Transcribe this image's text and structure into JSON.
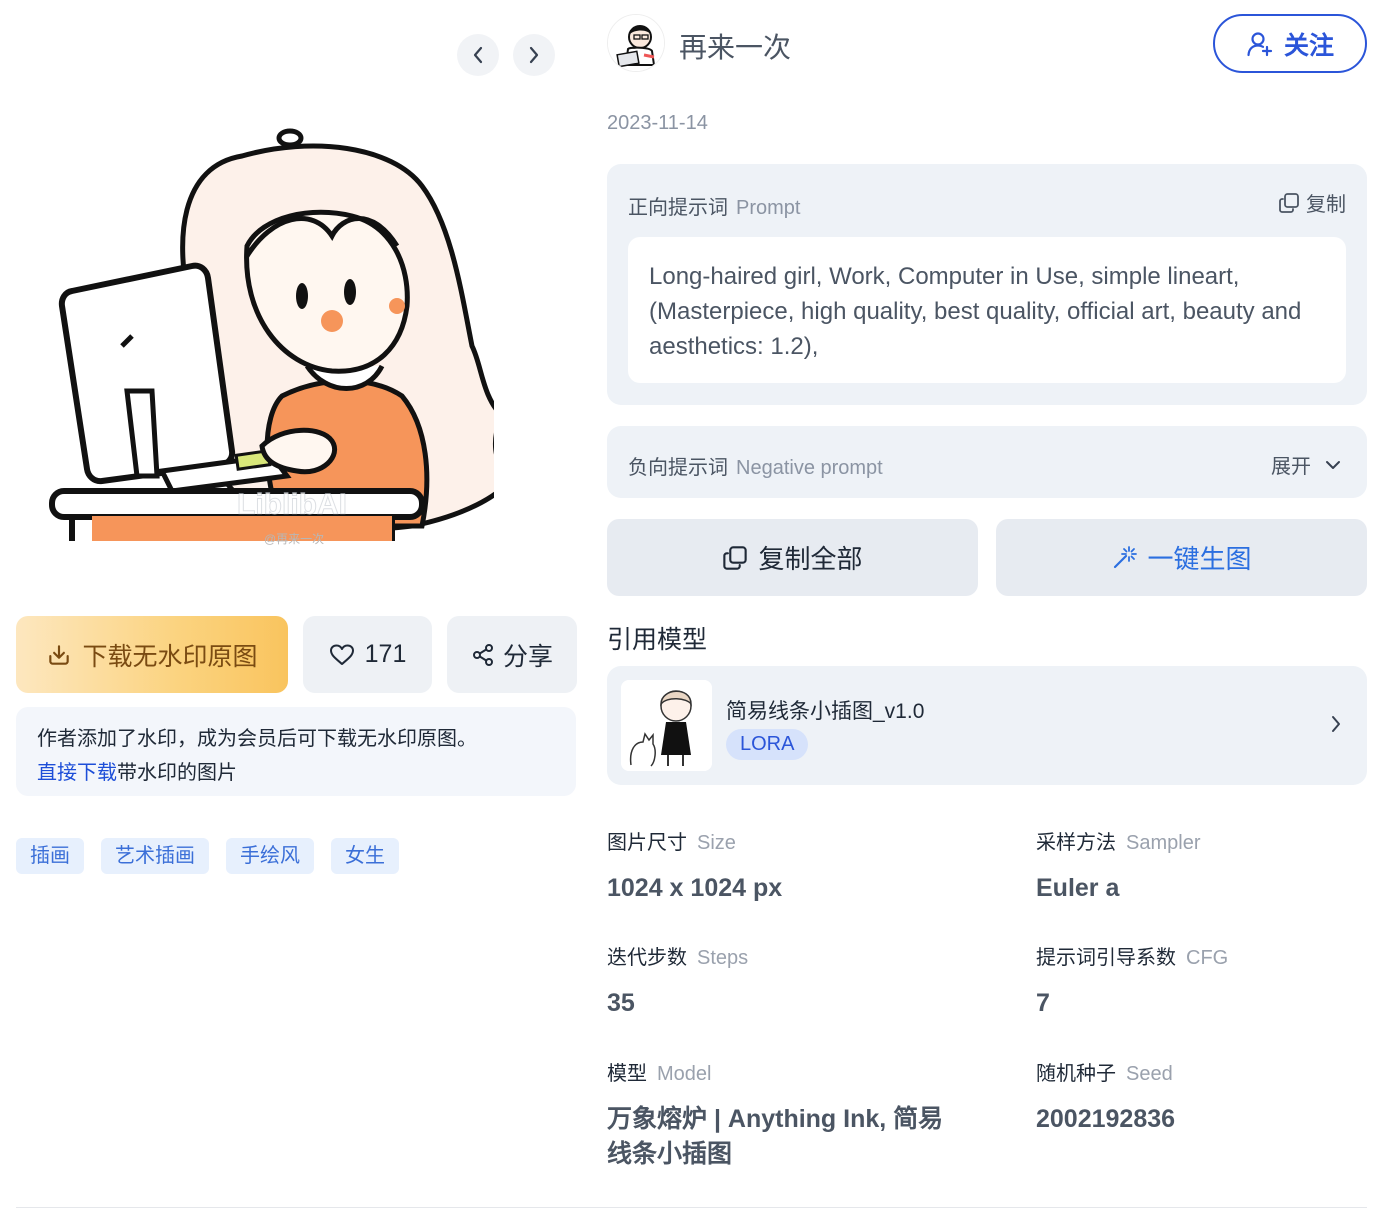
{
  "gallery": {
    "prev_icon": "chevron-left-icon",
    "next_icon": "chevron-right-icon",
    "image_watermark": "@再来一次",
    "artwork_caption_logo": "LiblibAI"
  },
  "actions": {
    "download_label": "下载无水印原图",
    "like_count": "171",
    "share_label": "分享"
  },
  "notice": {
    "text": "作者添加了水印，成为会员后可下载无水印原图。",
    "link_text": "直接下载",
    "link_suffix": "带水印的图片"
  },
  "tags": [
    "插画",
    "艺术插画",
    "手绘风",
    "女生"
  ],
  "author": {
    "name": "再来一次",
    "follow_label": "关注",
    "date": "2023-11-14"
  },
  "prompt": {
    "label": "正向提示词",
    "label_en": "Prompt",
    "copy_label": "复制",
    "text": "Long-haired girl, Work, Computer in Use, simple lineart, (Masterpiece, high quality, best quality, official art, beauty and aesthetics: 1.2),"
  },
  "negative": {
    "label": "负向提示词",
    "label_en": "Negative prompt",
    "expand_label": "展开"
  },
  "buttons": {
    "copy_all": "复制全部",
    "generate": "一键生图"
  },
  "models": {
    "title": "引用模型",
    "items": [
      {
        "name": "简易线条小插图_v1.0",
        "type": "LORA"
      }
    ]
  },
  "params": {
    "size": {
      "label": "图片尺寸",
      "label_en": "Size",
      "value": "1024 x 1024 px"
    },
    "sampler": {
      "label": "采样方法",
      "label_en": "Sampler",
      "value": "Euler a"
    },
    "steps": {
      "label": "迭代步数",
      "label_en": "Steps",
      "value": "35"
    },
    "cfg": {
      "label": "提示词引导系数",
      "label_en": "CFG",
      "value": "7"
    },
    "model": {
      "label": "模型",
      "label_en": "Model",
      "value": "万象熔炉 | Anything Ink, 简易线条小插图"
    },
    "seed": {
      "label": "随机种子",
      "label_en": "Seed",
      "value": "2002192836"
    }
  },
  "colors": {
    "accent_blue": "#2b55d9",
    "download_gold": "#f9c45e",
    "panel_bg": "#eef2f7",
    "tag_bg": "#e7f0fd"
  }
}
